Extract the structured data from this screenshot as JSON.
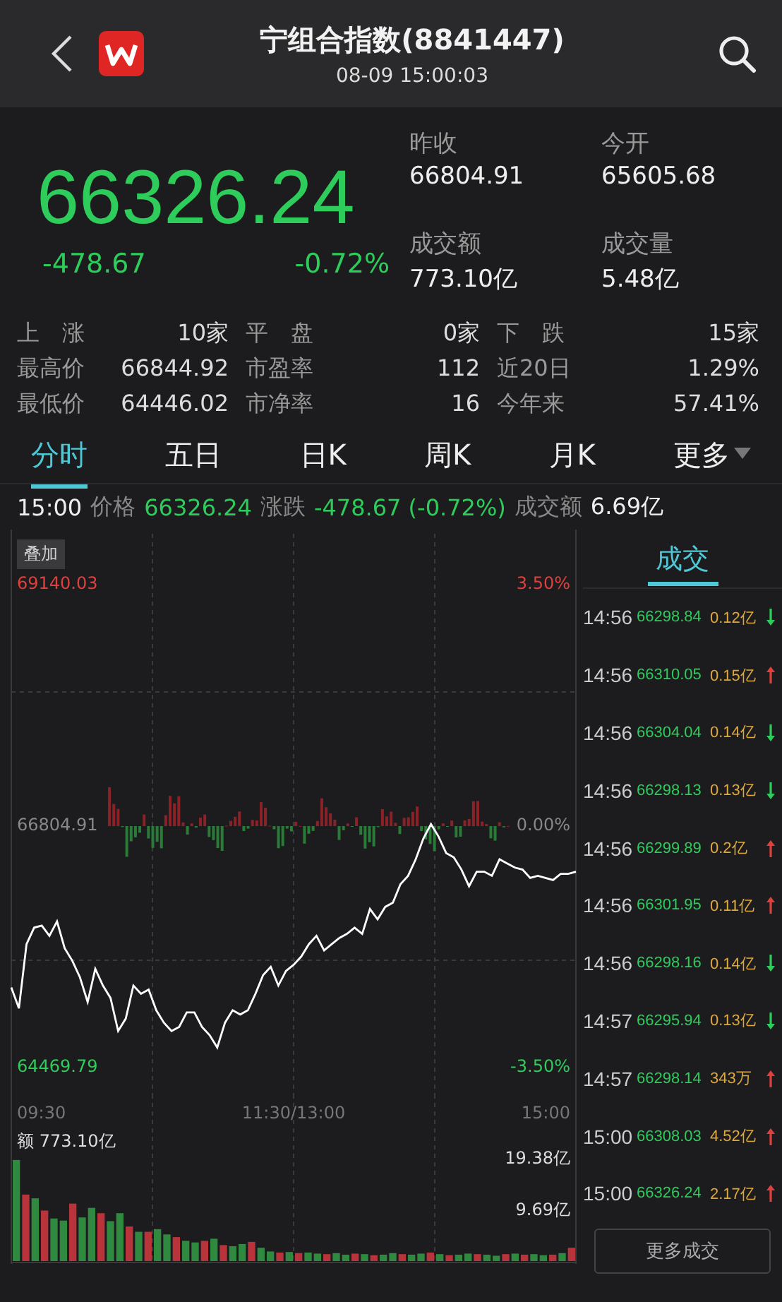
{
  "header": {
    "title": "宁组合指数(8841447)",
    "datetime": "08-09 15:00:03"
  },
  "quote": {
    "price": "66326.24",
    "change": "-478.67",
    "change_pct": "-0.72%",
    "stats": [
      {
        "label": "昨收",
        "value": "66804.91"
      },
      {
        "label": "今开",
        "value": "65605.68"
      },
      {
        "label": "成交额",
        "value": "773.10亿"
      },
      {
        "label": "成交量",
        "value": "5.48亿"
      }
    ]
  },
  "market_stats": [
    {
      "label": "上　涨",
      "value": "10家"
    },
    {
      "label": "平　盘",
      "value": "0家"
    },
    {
      "label": "下　跌",
      "value": "15家"
    },
    {
      "label": "最高价",
      "value": "66844.92"
    },
    {
      "label": "市盈率",
      "value": "112"
    },
    {
      "label": "近20日",
      "value": "1.29%"
    },
    {
      "label": "最低价",
      "value": "64446.02"
    },
    {
      "label": "市净率",
      "value": "16"
    },
    {
      "label": "今年来",
      "value": "57.41%"
    }
  ],
  "tabs": [
    {
      "label": "分时",
      "selected": true,
      "has_menu": false
    },
    {
      "label": "五日",
      "selected": false,
      "has_menu": false
    },
    {
      "label": "日K",
      "selected": false,
      "has_menu": false
    },
    {
      "label": "周K",
      "selected": false,
      "has_menu": false
    },
    {
      "label": "月K",
      "selected": false,
      "has_menu": false
    },
    {
      "label": "更多",
      "selected": false,
      "has_menu": true
    }
  ],
  "info_row": {
    "time": "15:00",
    "price_label": "价格",
    "price": "66326.24",
    "change_label": "涨跌",
    "change": "-478.67 (-0.72%)",
    "amount_label": "成交额",
    "amount": "6.69亿"
  },
  "overlay_button": "叠加",
  "price_chart": {
    "right_labels": [
      "3.50%",
      "0.00%",
      "-3.50%"
    ],
    "time_labels": [
      "09:30",
      "11:30/13:00",
      "15:00"
    ],
    "chart_data": {
      "type": "line",
      "ylim": [
        64196.67,
        69658.97
      ],
      "yticks": [
        {
          "value": 69140.03,
          "label": "69140.03"
        },
        {
          "value": 66804.91,
          "label": "66804.91"
        },
        {
          "value": 64469.79,
          "label": "64469.79"
        }
      ],
      "series": [
        {
          "color": "#ffffff",
          "values": [
            65230,
            65030,
            65650,
            65810,
            65830,
            65730,
            65870,
            65610,
            65490,
            65330,
            65090,
            65410,
            65250,
            65130,
            64810,
            64930,
            65250,
            65170,
            65210,
            65010,
            64890,
            64810,
            64850,
            64990,
            64990,
            64850,
            64770,
            64650,
            64890,
            65010,
            64970,
            65010,
            65170,
            65350,
            65430,
            65250,
            65390,
            65450,
            65530,
            65650,
            65730,
            65590,
            65650,
            65710,
            65750,
            65810,
            65750,
            65990,
            65890,
            66010,
            66050,
            66230,
            66310,
            66470,
            66670,
            66810,
            66690,
            66530,
            66490,
            66370,
            66210,
            66350,
            66350,
            66310,
            66470,
            66430,
            66390,
            66370,
            66290,
            66310,
            66290,
            66270,
            66330,
            66330,
            66350
          ]
        }
      ]
    }
  },
  "volume_chart": {
    "label": "额",
    "total": "773.10亿",
    "chart_data": {
      "type": "bar",
      "ylim": [
        0,
        31.33
      ],
      "yticks": [
        {
          "value": 19.38,
          "label": "19.38亿"
        },
        {
          "value": 9.69,
          "label": "9.69亿"
        }
      ],
      "series": [
        {
          "color": "#b8333a",
          "values": [
            null,
            12.5,
            null,
            9.5,
            null,
            null,
            10.8,
            null,
            null,
            9.0,
            null,
            null,
            6.5,
            null,
            5.5,
            null,
            null,
            4.5,
            null,
            null,
            3.8,
            null,
            3.0,
            null,
            null,
            3.6,
            null,
            null,
            1.6,
            null,
            1.5,
            null,
            null,
            1.3,
            null,
            null,
            1.4,
            null,
            1.1,
            null,
            null,
            1.3,
            null,
            null,
            1.6,
            null,
            1.1,
            null,
            null,
            1.3,
            null,
            null,
            1.3,
            null,
            1.2,
            null,
            null,
            1.2,
            null,
            2.5
          ]
        },
        {
          "color": "#2f8a40",
          "values": [
            19.0,
            null,
            11.8,
            null,
            8.0,
            7.6,
            null,
            8.2,
            10.0,
            null,
            7.5,
            9.0,
            null,
            5.5,
            null,
            6.0,
            5.0,
            null,
            3.8,
            3.5,
            null,
            4.2,
            null,
            2.8,
            3.2,
            null,
            2.5,
            1.8,
            null,
            1.7,
            null,
            1.6,
            1.4,
            null,
            1.5,
            1.2,
            null,
            1.3,
            null,
            1.2,
            1.5,
            null,
            1.2,
            1.4,
            null,
            1.3,
            null,
            1.2,
            1.4,
            null,
            1.2,
            1.0,
            null,
            1.4,
            null,
            1.3,
            1.1,
            null,
            1.5,
            null
          ]
        }
      ]
    }
  },
  "trades": {
    "tab": {
      "label": "成交",
      "selected": true
    },
    "rows": [
      {
        "time": "14:56",
        "price": "66298.84",
        "volume": "0.12亿",
        "rising": false
      },
      {
        "time": "14:56",
        "price": "66310.05",
        "volume": "0.15亿",
        "rising": true
      },
      {
        "time": "14:56",
        "price": "66304.04",
        "volume": "0.14亿",
        "rising": false
      },
      {
        "time": "14:56",
        "price": "66298.13",
        "volume": "0.13亿",
        "rising": false
      },
      {
        "time": "14:56",
        "price": "66299.89",
        "volume": "0.2亿",
        "rising": true
      },
      {
        "time": "14:56",
        "price": "66301.95",
        "volume": "0.11亿",
        "rising": true
      },
      {
        "time": "14:56",
        "price": "66298.16",
        "volume": "0.14亿",
        "rising": false
      },
      {
        "time": "14:57",
        "price": "66295.94",
        "volume": "0.13亿",
        "rising": false
      },
      {
        "time": "14:57",
        "price": "66298.14",
        "volume": "343万",
        "rising": true
      },
      {
        "time": "15:00",
        "price": "66308.03",
        "volume": "4.52亿",
        "rising": true
      },
      {
        "time": "15:00",
        "price": "66326.24",
        "volume": "2.17亿",
        "rising": true
      }
    ],
    "more_button": "更多成交"
  }
}
